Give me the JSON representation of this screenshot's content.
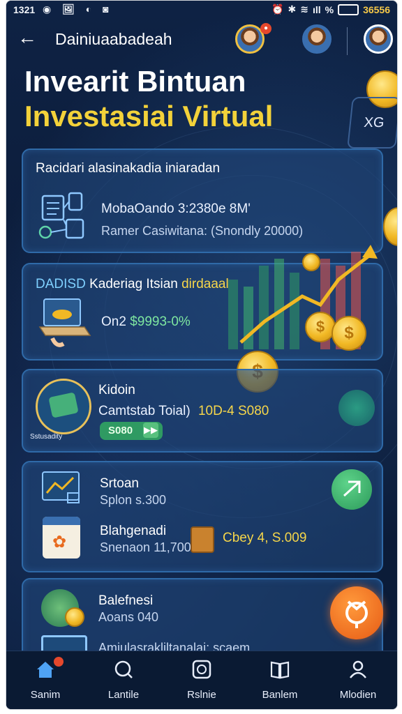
{
  "status_bar": {
    "time": "1321",
    "left_icons": "◉ 🖼 ◐ ◙",
    "battery_percent": "%",
    "battery_value": "36556"
  },
  "header": {
    "title": "Dainiuaabadeah"
  },
  "hero": {
    "line1": "Invearit Bintuan",
    "line2": "Investasiai Virtual",
    "tag": "XG"
  },
  "card1": {
    "title": "Racidari alasinakadia iniaradan",
    "line1": "MobaOando 3:2380e 8M'",
    "line2": "Ramer Casiwitana: (Snondly 20000)"
  },
  "card2": {
    "title_prefix": "DADISD",
    "title_mid": "Kaderiag Itsian",
    "title_suffix": "dirdaaal",
    "value_prefix": "On2",
    "value": "$9993-0%"
  },
  "card3": {
    "title": "Kidoin",
    "line_label": "Camtstab Toial)",
    "line_value": "10D-4 S080",
    "badge_label": "Sstusadity",
    "button_label": "S080",
    "button_arrow": "▶▶"
  },
  "card4": {
    "item1_title": "Srtoan",
    "item1_sub": "Splon s.300",
    "item2_title": "Blahgenadi",
    "item2_sub": "Snenaon 11,700",
    "item2_value": "Cbey 4, S.009"
  },
  "card5": {
    "title": "Balefnesi",
    "sub": "Aoans 040",
    "bottom": "Amiulasrakliltanalai: scaem"
  },
  "nav": {
    "items": [
      {
        "label": "Sanim"
      },
      {
        "label": "Lantile"
      },
      {
        "label": "Rslnie"
      },
      {
        "label": "Banlem"
      },
      {
        "label": "Mlodien"
      }
    ]
  },
  "colors": {
    "background": "#0c1e3c",
    "accent_yellow": "#f3d23a",
    "accent_green": "#2f9a62",
    "card_border": "#2f6aa8",
    "orange_button": "#f06a1e"
  }
}
